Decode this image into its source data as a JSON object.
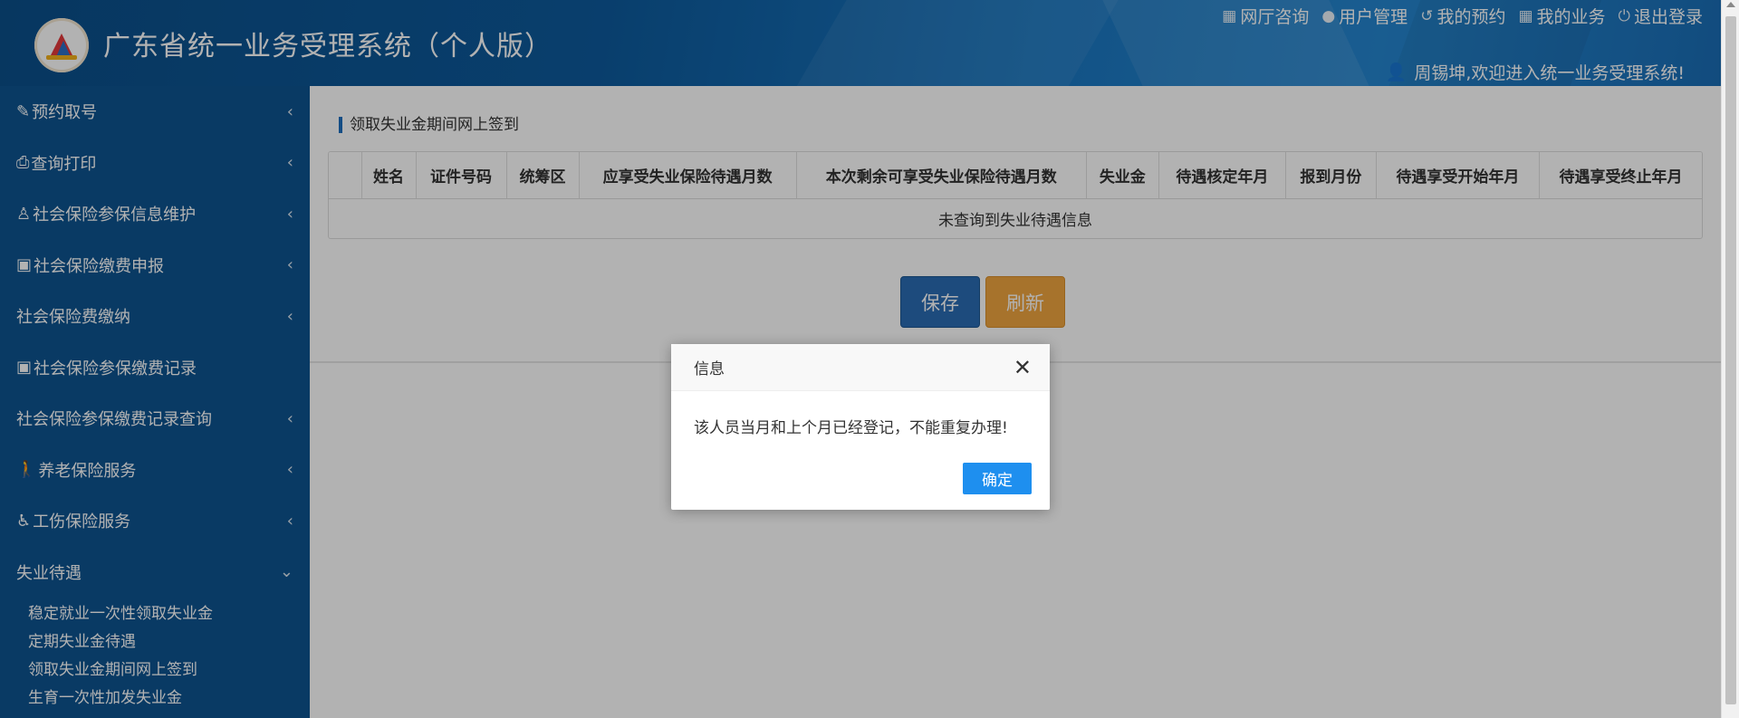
{
  "header": {
    "title": "广东省统一业务受理系统（个人版）",
    "nav": [
      {
        "label": "网厅咨询",
        "icon": "gift-icon"
      },
      {
        "label": "用户管理",
        "icon": "user-icon"
      },
      {
        "label": "我的预约",
        "icon": "history-icon"
      },
      {
        "label": "我的业务",
        "icon": "gift-icon"
      },
      {
        "label": "退出登录",
        "icon": "power-icon"
      }
    ],
    "welcome": "周锡坤,欢迎进入统一业务受理系统!"
  },
  "sidebar": {
    "items": [
      {
        "label": "预约取号",
        "icon": "edit-icon"
      },
      {
        "label": "查询打印",
        "icon": "print-icon"
      },
      {
        "label": "社会保险参保信息维护",
        "icon": "user-icon"
      },
      {
        "label": "社会保险缴费申报",
        "icon": "money-icon"
      },
      {
        "label": "社会保险费缴纳",
        "icon": ""
      },
      {
        "label": "社会保险参保缴费记录",
        "icon": "money-icon"
      },
      {
        "label": "社会保险参保缴费记录查询",
        "icon": ""
      },
      {
        "label": "养老保险服务",
        "icon": "walk-icon"
      },
      {
        "label": "工伤保险服务",
        "icon": "wheelchair-icon"
      },
      {
        "label": "失业待遇",
        "icon": ""
      }
    ],
    "submenu": [
      "稳定就业一次性领取失业金",
      "定期失业金待遇",
      "领取失业金期间网上签到",
      "生育一次性加发失业金"
    ]
  },
  "main": {
    "page_title": "领取失业金期间网上签到",
    "table": {
      "columns": [
        "",
        "姓名",
        "证件号码",
        "统筹区",
        "应享受失业保险待遇月数",
        "本次剩余可享受失业保险待遇月数",
        "失业金",
        "待遇核定年月",
        "报到月份",
        "待遇享受开始年月",
        "待遇享受终止年月"
      ],
      "empty_text": "未查询到失业待遇信息"
    },
    "buttons": {
      "save": "保存",
      "refresh": "刷新"
    }
  },
  "dialog": {
    "title": "信息",
    "message": "该人员当月和上个月已经登记，不能重复办理!",
    "ok": "确定"
  }
}
